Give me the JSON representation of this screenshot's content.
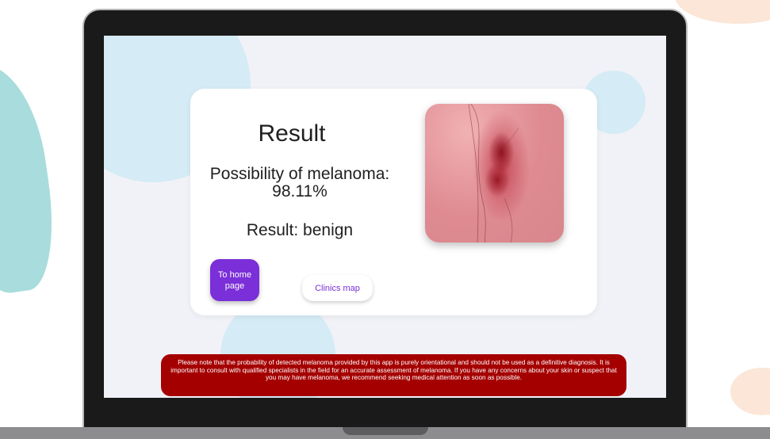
{
  "app": {
    "title": "Result",
    "probability_text": "Possibility of melanoma: 98.11%",
    "result_text": "Result: benign"
  },
  "buttons": {
    "home_label": "To home page",
    "map_label": "Clinics map"
  },
  "disclaimer": {
    "text": "Please note that the probability of detected melanoma provided by this app is purely orientational and should not be used as a definitive diagnosis. It is important to consult with qualified specialists in the field for an accurate assessment of melanoma. If you have any concerns about your skin or suspect that you may have melanoma, we recommend seeking medical attention as soon as possible."
  },
  "colors": {
    "accent": "#7a2fd8",
    "warning": "#a50000",
    "screen_bg": "#f1f2f8",
    "bubble": "#d5ebf5"
  }
}
